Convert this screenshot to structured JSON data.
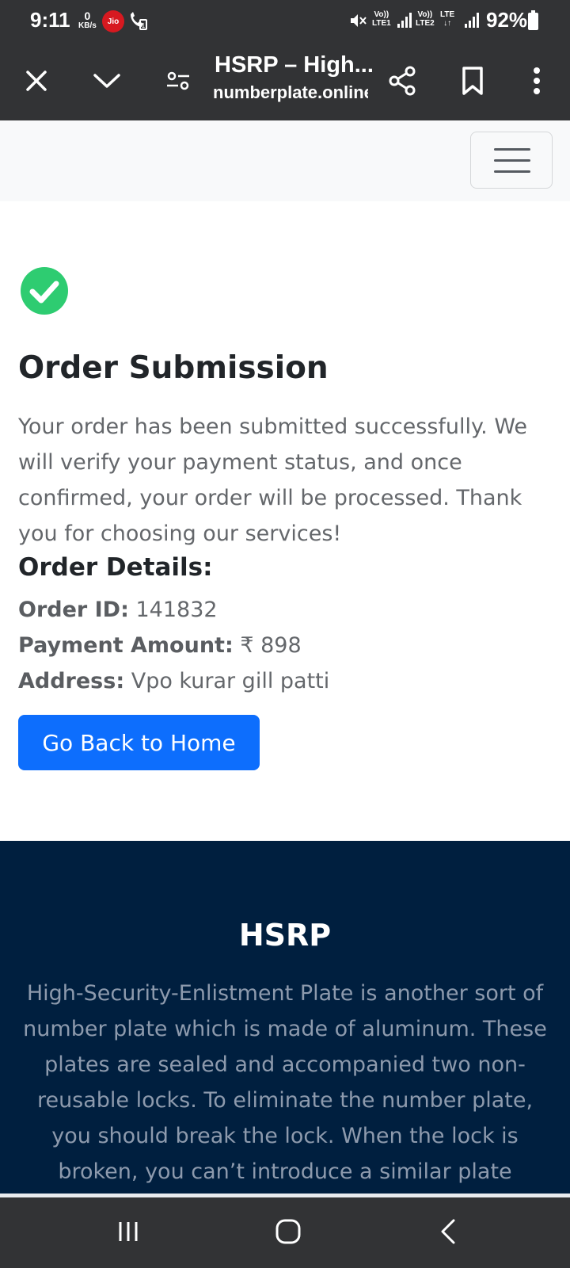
{
  "status_bar": {
    "time": "9:11",
    "speed_value": "0",
    "speed_unit": "KB/s",
    "carrier_badge": "Jio",
    "sim1_label_top": "Vo))",
    "sim1_label_bottom": "LTE1",
    "sim2_label_top": "Vo))",
    "sim2_label_bottom": "LTE2",
    "lte_label": "LTE",
    "battery": "92%"
  },
  "browser": {
    "title": "HSRP – High...",
    "url": "numberplate.online"
  },
  "order": {
    "title": "Order Submission",
    "message": "Your order has been submitted successfully. We will verify your payment status, and once confirmed, your order will be processed. Thank you for choosing our services!",
    "details_title": "Order Details:",
    "order_id_label": "Order ID:",
    "order_id_value": "141832",
    "payment_label": "Payment Amount:",
    "payment_value": "₹ 898",
    "address_label": "Address:",
    "address_value": "Vpo kurar gill patti",
    "home_button": "Go Back to Home"
  },
  "footer": {
    "title": "HSRP",
    "text": "High-Security-Enlistment Plate is another sort of number plate which is made of aluminum. These plates are sealed and accompanied two non-reusable locks. To eliminate the number plate, you should break the lock. When the lock is broken, you can’t introduce a similar plate"
  },
  "colors": {
    "success_green": "#2ecc71",
    "primary_button": "#0d6efd",
    "footer_bg": "#001f3f",
    "browser_bar": "#323335"
  },
  "icons": {
    "close": "close-icon",
    "expand": "chevron-down-icon",
    "site_settings": "tune-icon",
    "share": "share-icon",
    "bookmark": "bookmark-icon",
    "menu": "more-vert-icon",
    "hamburger": "hamburger-icon",
    "success": "check-circle-icon"
  }
}
